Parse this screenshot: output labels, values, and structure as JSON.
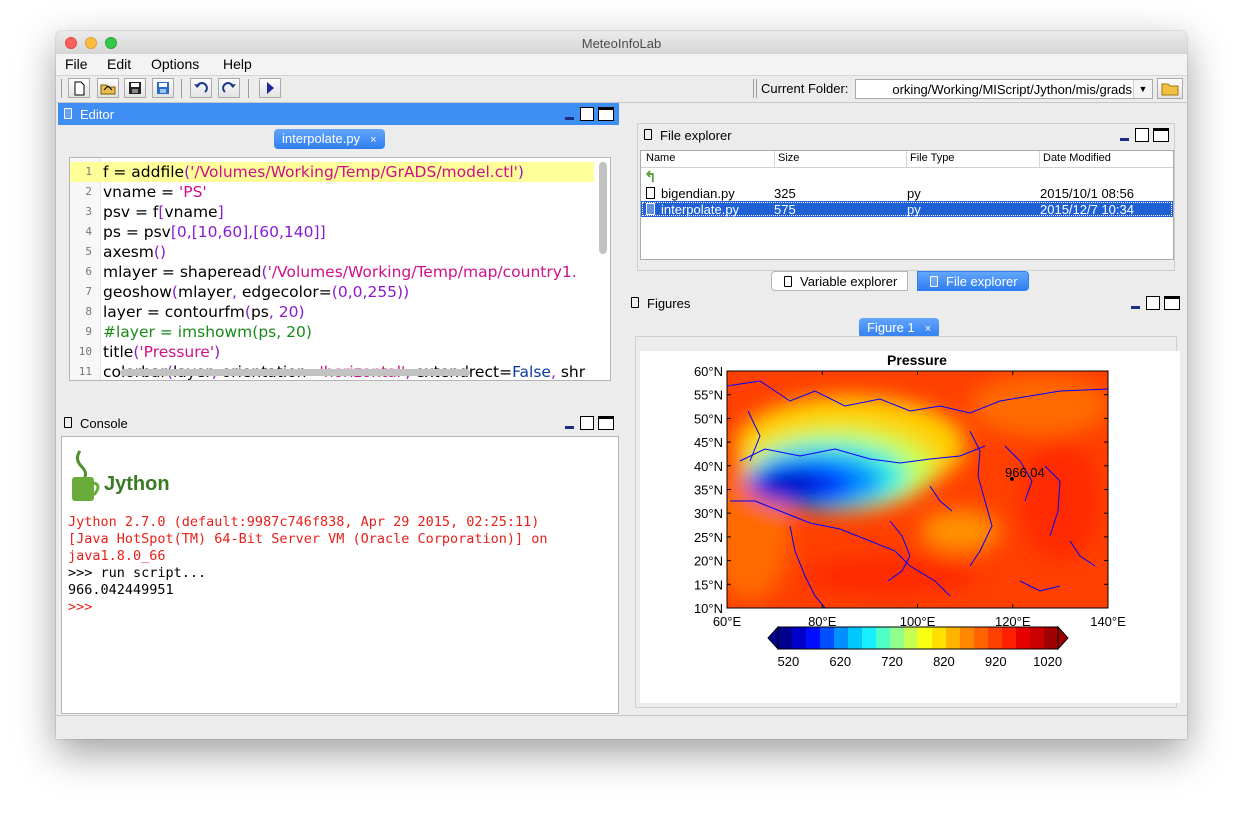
{
  "app": {
    "title": "MeteoInfoLab"
  },
  "menus": [
    "File",
    "Edit",
    "Options",
    "Help"
  ],
  "toolbar": {
    "current_folder_label": "Current Folder:",
    "current_folder_path": "orking/Working/MIScript/Jython/mis/grads"
  },
  "editor": {
    "panel_title": "Editor",
    "tab_label": "interpolate.py",
    "tab_close": "×",
    "lines": [
      {
        "num": "1",
        "text": "f = addfile('/Volumes/Working/Temp/GrADS/model.ctl')"
      },
      {
        "num": "2",
        "text": "vname = 'PS'"
      },
      {
        "num": "3",
        "text": "psv = f[vname]"
      },
      {
        "num": "4",
        "text": "ps = psv[0,[10,60],[60,140]]"
      },
      {
        "num": "5",
        "text": "axesm()"
      },
      {
        "num": "6",
        "text": "mlayer = shaperead('/Volumes/Working/Temp/map/country1."
      },
      {
        "num": "7",
        "text": "geoshow(mlayer, edgecolor=(0,0,255))"
      },
      {
        "num": "8",
        "text": "layer = contourfm(ps, 20)"
      },
      {
        "num": "9",
        "text": "#layer = imshowm(ps, 20)"
      },
      {
        "num": "10",
        "text": "title('Pressure')"
      },
      {
        "num": "11",
        "text": "colorbar(layer, orientation='horizontal', extendrect=False, shr"
      }
    ]
  },
  "console": {
    "panel_title": "Console",
    "logo_text": "Jython",
    "lines": [
      {
        "text": "Jython 2.7.0 (default:9987c746f838, Apr 29 2015, 02:25:11)",
        "color": "red"
      },
      {
        "text": "[Java HotSpot(TM) 64-Bit Server VM (Oracle Corporation)] on",
        "color": "red"
      },
      {
        "text": "java1.8.0_66",
        "color": "red"
      },
      {
        "text": ">>> run script...",
        "color": "black"
      },
      {
        "text": "966.042449951",
        "color": "black"
      },
      {
        "text": ">>>",
        "color": "red"
      }
    ]
  },
  "file_explorer": {
    "panel_title": "File explorer",
    "columns": [
      "Name",
      "Size",
      "File Type",
      "Date Modified"
    ],
    "rows": [
      {
        "name": "bigendian.py",
        "size": "325",
        "type": "py",
        "date": "2015/10/1 08:56",
        "selected": false
      },
      {
        "name": "interpolate.py",
        "size": "575",
        "type": "py",
        "date": "2015/12/7 10:34",
        "selected": true
      }
    ],
    "tabs": [
      "Variable explorer",
      "File explorer"
    ],
    "active_tab": "File explorer"
  },
  "figures": {
    "panel_title": "Figures",
    "tab_label": "Figure 1",
    "tab_close": "×"
  },
  "chart_data": {
    "type": "heatmap",
    "title": "Pressure",
    "xlabel": "",
    "ylabel": "",
    "xlim": [
      60,
      140
    ],
    "ylim": [
      10,
      60
    ],
    "x_ticks": [
      "60°E",
      "80°E",
      "100°E",
      "120°E",
      "140°E"
    ],
    "y_ticks": [
      "10°N",
      "15°N",
      "20°N",
      "25°N",
      "30°N",
      "35°N",
      "40°N",
      "45°N",
      "50°N",
      "55°N",
      "60°N"
    ],
    "annotation": {
      "text": "966.04",
      "lon": 122,
      "lat": 40
    },
    "colorbar": {
      "orientation": "horizontal",
      "ticks": [
        "520",
        "620",
        "720",
        "820",
        "920",
        "1020"
      ],
      "min": 500,
      "max": 1040,
      "colors": [
        "#00008f",
        "#0000c8",
        "#0010ff",
        "#0050ff",
        "#0090ff",
        "#00c8ff",
        "#18f0ff",
        "#50ffc8",
        "#90ff90",
        "#c8ff50",
        "#f8ff10",
        "#ffe000",
        "#ffb400",
        "#ff8800",
        "#ff6400",
        "#ff4000",
        "#ff2000",
        "#e80000",
        "#c80000",
        "#a00000"
      ]
    },
    "colors": {
      "continent_edges": "#0000ff",
      "low": "#0000c8",
      "high": "#ff2000"
    }
  }
}
